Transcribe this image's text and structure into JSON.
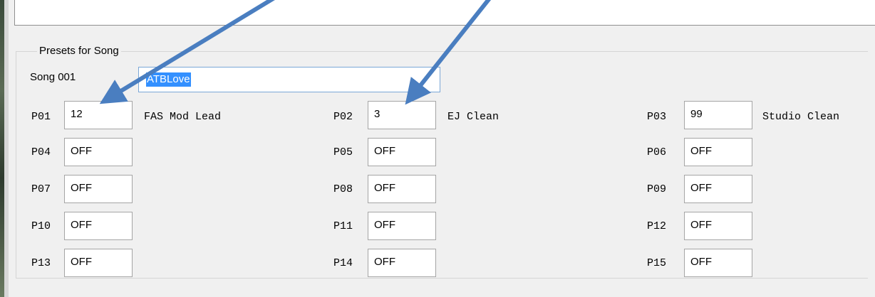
{
  "group": {
    "title": "Presets for Song"
  },
  "song": {
    "label": "Song 001",
    "name": "ATBLove"
  },
  "presets": [
    {
      "id": "P01",
      "value": "12",
      "name": "FAS Mod Lead"
    },
    {
      "id": "P02",
      "value": "3",
      "name": "EJ Clean"
    },
    {
      "id": "P03",
      "value": "99",
      "name": "Studio Clean"
    },
    {
      "id": "P04",
      "value": "OFF",
      "name": ""
    },
    {
      "id": "P05",
      "value": "OFF",
      "name": ""
    },
    {
      "id": "P06",
      "value": "OFF",
      "name": ""
    },
    {
      "id": "P07",
      "value": "OFF",
      "name": ""
    },
    {
      "id": "P08",
      "value": "OFF",
      "name": ""
    },
    {
      "id": "P09",
      "value": "OFF",
      "name": ""
    },
    {
      "id": "P10",
      "value": "OFF",
      "name": ""
    },
    {
      "id": "P11",
      "value": "OFF",
      "name": ""
    },
    {
      "id": "P12",
      "value": "OFF",
      "name": ""
    },
    {
      "id": "P13",
      "value": "OFF",
      "name": ""
    },
    {
      "id": "P14",
      "value": "OFF",
      "name": ""
    },
    {
      "id": "P15",
      "value": "OFF",
      "name": ""
    }
  ],
  "colors": {
    "arrow": "#4a7ec0",
    "selection": "#3390ff",
    "focus_border": "#7aa7d6"
  }
}
